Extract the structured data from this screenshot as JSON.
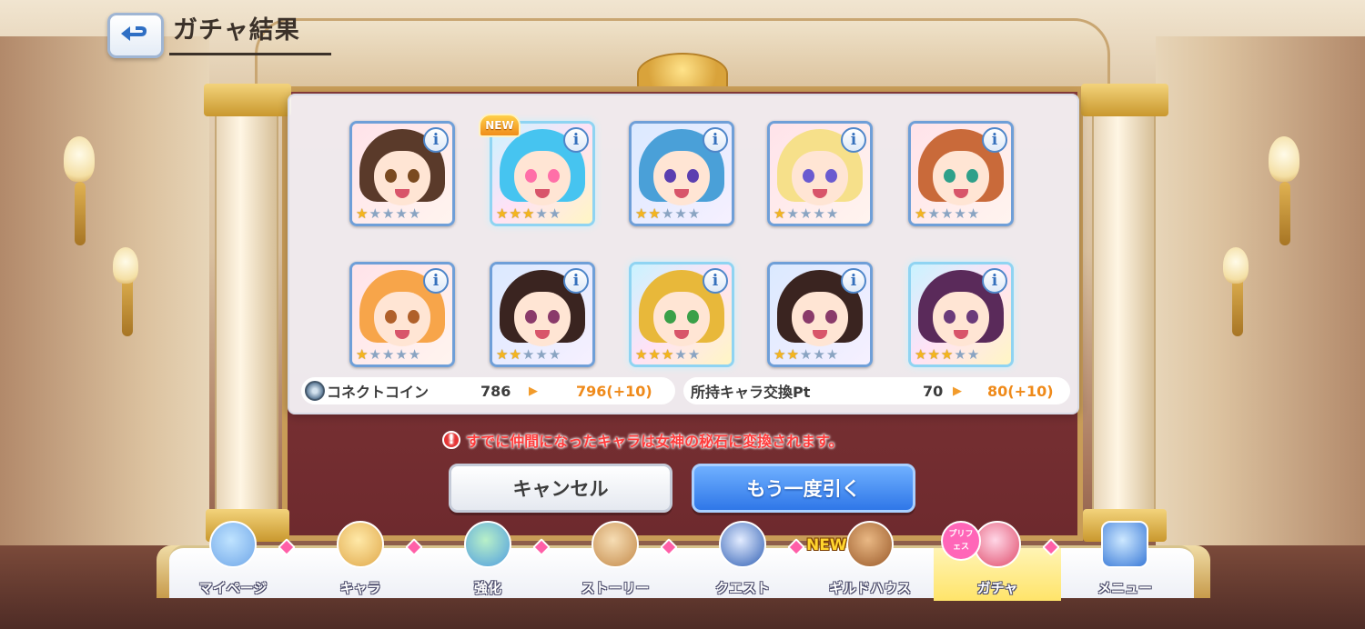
{
  "header": {
    "title": "ガチャ結果"
  },
  "cards": [
    {
      "id": "c1",
      "stars": 1,
      "is_new": false,
      "hair": "#5a3a2a",
      "eye": "#7a4a20"
    },
    {
      "id": "c2",
      "stars": 3,
      "is_new": true,
      "hair": "#46c4f0",
      "eye": "#ff6fa8"
    },
    {
      "id": "c3",
      "stars": 2,
      "is_new": false,
      "hair": "#4aa0d8",
      "eye": "#5b3fb0"
    },
    {
      "id": "c4",
      "stars": 1,
      "is_new": false,
      "hair": "#f6e08a",
      "eye": "#6a5bd0"
    },
    {
      "id": "c5",
      "stars": 1,
      "is_new": false,
      "hair": "#c96a3a",
      "eye": "#2fa08a"
    },
    {
      "id": "c6",
      "stars": 1,
      "is_new": false,
      "hair": "#f7a54a",
      "eye": "#b0602a"
    },
    {
      "id": "c7",
      "stars": 2,
      "is_new": false,
      "hair": "#3a2420",
      "eye": "#8a3a6a"
    },
    {
      "id": "c8",
      "stars": 3,
      "is_new": false,
      "hair": "#e8b83a",
      "eye": "#3aa048"
    },
    {
      "id": "c9",
      "stars": 2,
      "is_new": false,
      "hair": "#3a2420",
      "eye": "#8a3a6a"
    },
    {
      "id": "c10",
      "stars": 3,
      "is_new": false,
      "hair": "#5a2a5a",
      "eye": "#6a3a7a"
    }
  ],
  "new_badge": "NEW",
  "info_glyph": "i",
  "exchange": {
    "coin_label": "コネクトコイン",
    "coin_old": "786",
    "coin_new": "796(+10)",
    "pt_label": "所持キャラ交換Pt",
    "pt_old": "70",
    "pt_new": "80(+10)",
    "arrow": "▶"
  },
  "warning": {
    "icon": "!",
    "text": "すでに仲間になったキャラは女神の秘石に変換されます。"
  },
  "buttons": {
    "cancel": "キャンセル",
    "draw_again": "もう一度引く"
  },
  "nav": [
    {
      "label": "マイページ",
      "icon": "castle-icon",
      "active": false,
      "badge": true
    },
    {
      "label": "キャラ",
      "icon": "character-icon",
      "active": false,
      "badge": true
    },
    {
      "label": "強化",
      "icon": "enhance-icon",
      "active": false,
      "badge": true
    },
    {
      "label": "ストーリー",
      "icon": "scroll-icon",
      "active": false,
      "badge": true
    },
    {
      "label": "クエスト",
      "icon": "sword-flag-icon",
      "active": false,
      "badge": true
    },
    {
      "label": "ギルドハウス",
      "icon": "guild-door-icon",
      "active": false,
      "badge": false,
      "new": "NEW"
    },
    {
      "label": "ガチャ",
      "icon": "gacha-icon",
      "active": true,
      "badge": true,
      "prifes": "プリフェス"
    },
    {
      "label": "メニュー",
      "icon": "crystal-icon",
      "active": false,
      "badge": false
    }
  ],
  "colors": {
    "star_on": "#f4b51e",
    "star_off": "#8aa4c2",
    "accent_blue": "#2f77e8",
    "warning_red": "#ff3b3b",
    "exchange_orange": "#ef8a1a",
    "badge_pink": "#ff5fa8"
  }
}
